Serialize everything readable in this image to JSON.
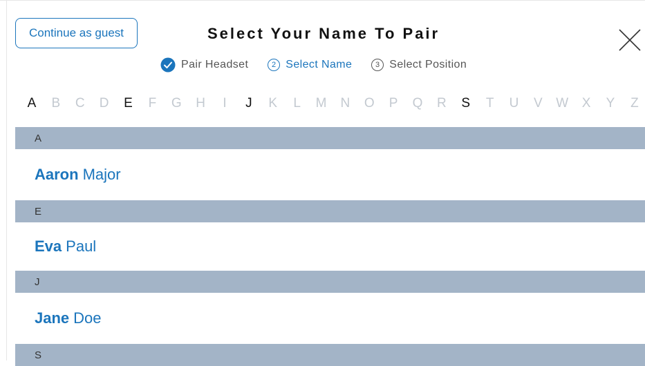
{
  "header": {
    "guest_label": "Continue as guest",
    "title": "Select Your Name To Pair",
    "close_icon": "close-icon"
  },
  "steps": [
    {
      "number": "",
      "label": "Pair Headset",
      "state": "done",
      "icon": "checkmark-circle-icon"
    },
    {
      "number": "2",
      "label": "Select Name",
      "state": "active"
    },
    {
      "number": "3",
      "label": "Select Position",
      "state": "pending"
    }
  ],
  "alphabet": {
    "letters": [
      "A",
      "B",
      "C",
      "D",
      "E",
      "F",
      "G",
      "H",
      "I",
      "J",
      "K",
      "L",
      "M",
      "N",
      "O",
      "P",
      "Q",
      "R",
      "S",
      "T",
      "U",
      "V",
      "W",
      "X",
      "Y",
      "Z"
    ],
    "enabled": [
      "A",
      "E",
      "J",
      "S"
    ]
  },
  "sections": [
    {
      "letter": "A",
      "people": [
        {
          "first": "Aaron",
          "last": "Major"
        }
      ]
    },
    {
      "letter": "E",
      "people": [
        {
          "first": "Eva",
          "last": "Paul"
        }
      ]
    },
    {
      "letter": "J",
      "people": [
        {
          "first": "Jane",
          "last": "Doe"
        }
      ]
    },
    {
      "letter": "S",
      "people": []
    }
  ],
  "colors": {
    "accent": "#1b75bc",
    "section_header_bg": "#a3b4c7",
    "disabled_letter": "#c3c9d0",
    "enabled_letter": "#111111"
  }
}
